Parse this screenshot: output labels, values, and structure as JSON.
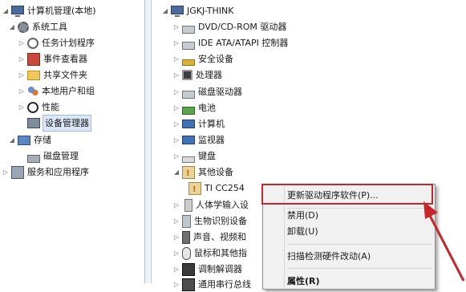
{
  "left_tree": {
    "root": "计算机管理(本地)",
    "items": [
      {
        "label": "系统工具",
        "icon": "gear-icon"
      },
      {
        "label": "任务计划程序",
        "icon": "clock-icon"
      },
      {
        "label": "事件查看器",
        "icon": "book-icon"
      },
      {
        "label": "共享文件夹",
        "icon": "folder-icon"
      },
      {
        "label": "本地用户和组",
        "icon": "users-icon"
      },
      {
        "label": "性能",
        "icon": "performance-icon"
      },
      {
        "label": "设备管理器",
        "icon": "device-manager-icon"
      },
      {
        "label": "存储",
        "icon": "storage-icon"
      },
      {
        "label": "磁盘管理",
        "icon": "disk-icon"
      },
      {
        "label": "服务和应用程序",
        "icon": "services-icon"
      }
    ]
  },
  "right_tree": {
    "root": "JGKJ-THINK",
    "items": [
      {
        "label": "DVD/CD-ROM 驱动器",
        "icon": "dvd-drive-icon"
      },
      {
        "label": "IDE ATA/ATAPI 控制器",
        "icon": "ide-controller-icon"
      },
      {
        "label": "安全设备",
        "icon": "key-icon"
      },
      {
        "label": "处理器",
        "icon": "processor-icon"
      },
      {
        "label": "磁盘驱动器",
        "icon": "disk-drive-icon"
      },
      {
        "label": "电池",
        "icon": "battery-icon"
      },
      {
        "label": "计算机",
        "icon": "computer-icon"
      },
      {
        "label": "监视器",
        "icon": "monitor-icon"
      },
      {
        "label": "键盘",
        "icon": "keyboard-icon"
      },
      {
        "label": "其他设备",
        "icon": "unknown-device-icon"
      },
      {
        "label": "TI CC254",
        "icon": "warning-device-icon"
      },
      {
        "label": "人体学输入设",
        "icon": "hid-icon"
      },
      {
        "label": "生物识别设备",
        "icon": "biometric-icon"
      },
      {
        "label": "声音、视频和",
        "icon": "sound-icon"
      },
      {
        "label": "鼠标和其他指",
        "icon": "mouse-icon"
      },
      {
        "label": "调制解调器",
        "icon": "modem-icon"
      },
      {
        "label": "通用串行总线",
        "icon": "usb-icon"
      }
    ]
  },
  "context_menu": {
    "items": [
      {
        "label": "更新驱动程序软件(P)..."
      },
      {
        "label": "禁用(D)"
      },
      {
        "label": "卸载(U)"
      },
      {
        "label": "扫描检测硬件改动(A)"
      },
      {
        "label": "属性(R)"
      }
    ],
    "highlight_color": "#c9262c"
  },
  "annotation": {
    "arrow_color": "#c9262c"
  }
}
